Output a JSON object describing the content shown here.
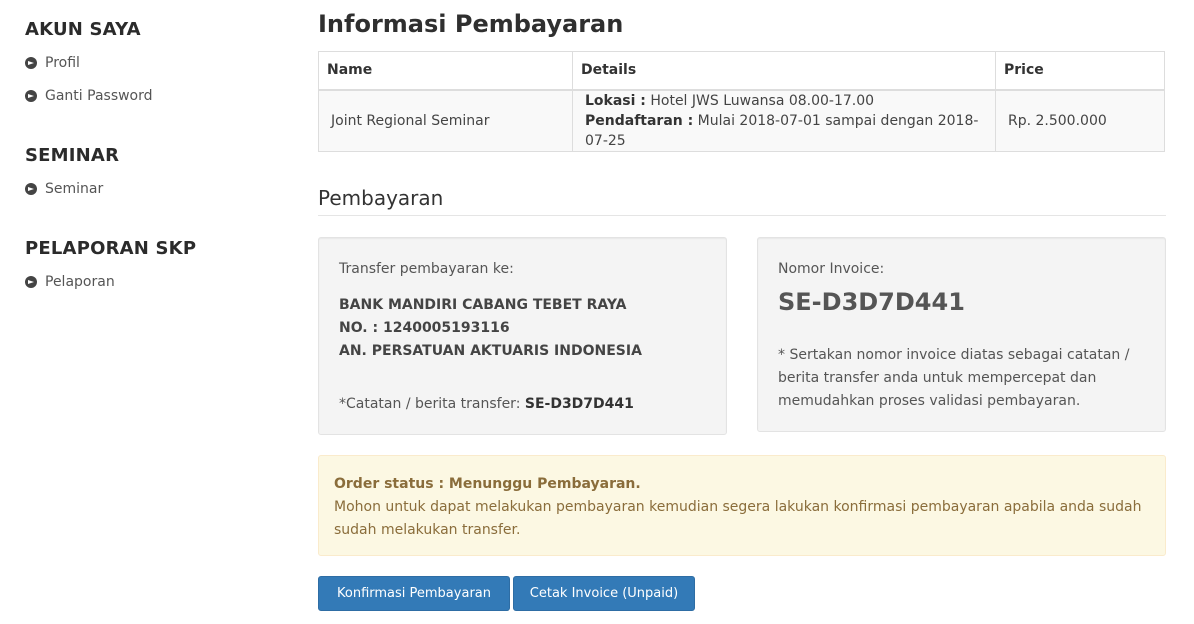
{
  "sidebar": {
    "sections": [
      {
        "heading": "AKUN SAYA",
        "items": [
          {
            "label": "Profil"
          },
          {
            "label": "Ganti Password"
          }
        ]
      },
      {
        "heading": "SEMINAR",
        "items": [
          {
            "label": "Seminar"
          }
        ]
      },
      {
        "heading": "PELAPORAN SKP",
        "items": [
          {
            "label": "Pelaporan"
          }
        ]
      }
    ]
  },
  "page": {
    "title": "Informasi Pembayaran"
  },
  "table": {
    "headers": {
      "name": "Name",
      "details": "Details",
      "price": "Price"
    },
    "row": {
      "name": "Joint Regional Seminar",
      "lokasi_label": "Lokasi :",
      "lokasi_value": " Hotel JWS Luwansa 08.00-17.00",
      "pendaftaran_label": "Pendaftaran :",
      "pendaftaran_value": " Mulai 2018-07-01 sampai dengan 2018-07-25",
      "price": "Rp. 2.500.000"
    }
  },
  "payment": {
    "section_title": "Pembayaran",
    "transfer_label": "Transfer pembayaran ke:",
    "bank_lines": [
      "BANK MANDIRI CABANG TEBET RAYA",
      "NO. : 1240005193116",
      "AN. PERSATUAN AKTUARIS INDONESIA"
    ],
    "note_label": "*Catatan / berita transfer: ",
    "note_value": "SE-D3D7D441",
    "invoice_label": "Nomor Invoice:",
    "invoice_number": "SE-D3D7D441",
    "invoice_note": "* Sertakan nomor invoice diatas sebagai catatan / berita transfer anda untuk mempercepat dan memudahkan proses validasi pembayaran."
  },
  "alert": {
    "status": "Order status : Menunggu Pembayaran.",
    "message": "Mohon untuk dapat melakukan pembayaran kemudian segera lakukan konfirmasi pembayaran apabila anda sudah sudah melakukan transfer."
  },
  "buttons": {
    "confirm": "Konfirmasi Pembayaran",
    "print": "Cetak Invoice (Unpaid)"
  },
  "colors": {
    "primary": "#337ab7",
    "alert_bg": "#fcf8e3",
    "alert_text": "#8a6d3b",
    "well_bg": "#f4f4f4"
  }
}
